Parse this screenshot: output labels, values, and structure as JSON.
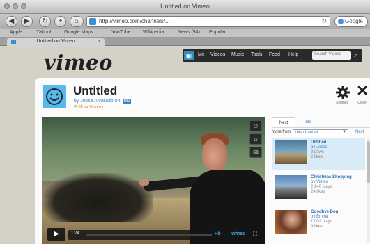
{
  "browser": {
    "window_title": "Untitled on Vimeo",
    "url": "http://vimeo.com/channels/...",
    "search_placeholder": "Google",
    "back_label": "◀",
    "forward_label": "▶",
    "reload_label": "↻",
    "add_label": "+",
    "bookmarks": [
      "Apple",
      "Yahoo!",
      "Google Maps",
      "YouTube",
      "Wikipedia",
      "News (94)",
      "Popular"
    ],
    "tab_label": "Untitled on Vimeo",
    "tab_close": "×"
  },
  "vimeo": {
    "logo": "vimeo",
    "nav": [
      "Me",
      "Videos",
      "Music",
      "Tools",
      "Feed",
      "Help"
    ],
    "home_icon": "▣",
    "search_placeholder": "Search Videos"
  },
  "video": {
    "title": "Untitled",
    "byline": "by Jesse Alvarado on",
    "hd_badge": "HD",
    "follow_text": "Follow Vimeo",
    "settings_label": "Settings",
    "close_label": "Close",
    "close_glyph": "✕"
  },
  "player": {
    "play_glyph": "▶",
    "time": "1:24",
    "hd_label": "HD",
    "logo_label": "vimeo",
    "fullscreen_glyph": "⛶",
    "side_buttons": [
      "☺",
      "⌂",
      "✉"
    ]
  },
  "sidebar": {
    "tabs": [
      "Next",
      "Info"
    ],
    "more_label": "More from",
    "select_value": "this channel",
    "select_arrow": "▼",
    "next_label": "Next",
    "items": [
      {
        "title": "Untitled",
        "by": "by Jesse",
        "stat1": "3 plays",
        "stat2": "2 likes"
      },
      {
        "title": "Christmas Shopping",
        "by": "by Vimeo",
        "stat1": "2,140 plays",
        "stat2": "24 likes"
      },
      {
        "title": "Goodbye Dog",
        "by": "by Emma",
        "stat1": "1,002 plays",
        "stat2": "9 likes"
      }
    ]
  }
}
